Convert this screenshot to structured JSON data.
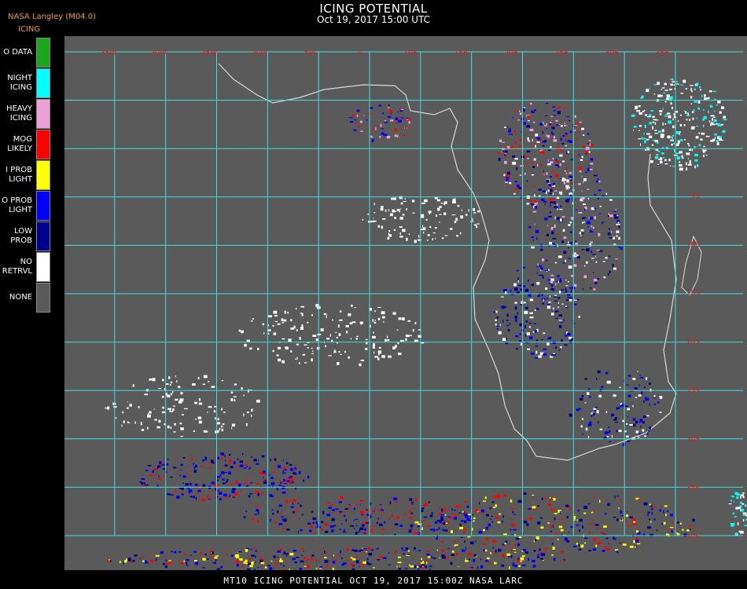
{
  "header": {
    "credit": "NASA Langley (M04.0)",
    "legend_title": "ICING",
    "title": "ICING POTENTIAL",
    "subtitle": "Oct 19, 2017 15:00 UTC"
  },
  "legend": [
    {
      "label": "O DATA",
      "color": "#1aa81a"
    },
    {
      "label": "NIGHT\nICING",
      "color": "#00ffff"
    },
    {
      "label": "HEAVY\nICING",
      "color": "#f0a0d8"
    },
    {
      "label": "MOG\nLIKELY",
      "color": "#ff0000"
    },
    {
      "label": "I PROB\nLIGHT",
      "color": "#ffff00"
    },
    {
      "label": "O PROB\nLIGHT",
      "color": "#0000ff"
    },
    {
      "label": "LOW\nPROB",
      "color": "#000090"
    },
    {
      "label": "NO\nRETRVL",
      "color": "#ffffff"
    },
    {
      "label": "NONE",
      "color": "#5a5a5a"
    }
  ],
  "map": {
    "background_color": "#5a5a5a",
    "grid_color": "#40e0e0",
    "coastline_color": "#d8d8d8",
    "label_color": "#d02020",
    "lon_labels": [
      "35W",
      "30W",
      "25W",
      "20W",
      "5W",
      "0",
      "10E",
      "15E",
      "20E",
      "25E",
      "30E",
      "35E"
    ],
    "lat_labels": [
      "0",
      "5S",
      "10S",
      "15S",
      "20S",
      "25S",
      "30S",
      "35S",
      "40S"
    ]
  },
  "footer": {
    "text": "MT10  ICING POTENTIAL   OCT 19, 2017 15:00Z   NASA LARC"
  }
}
